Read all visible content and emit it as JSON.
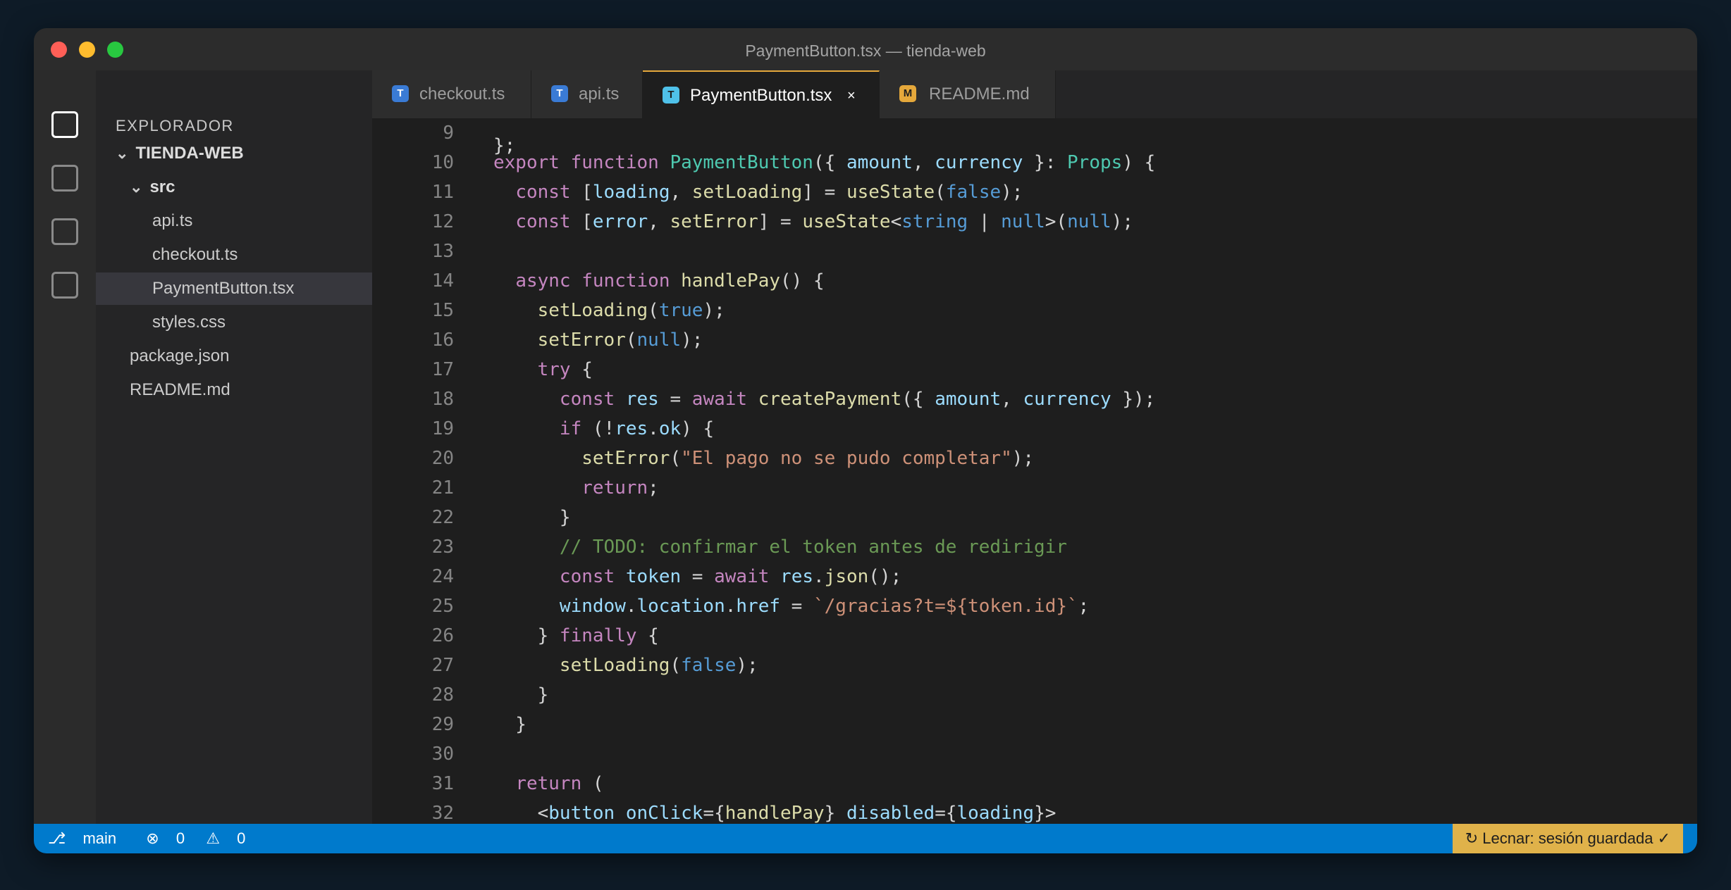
{
  "window": {
    "title": "PaymentButton.tsx — tienda-web"
  },
  "activity_bar": {
    "icons": [
      "explorer-icon",
      "search-icon",
      "source-control-icon",
      "extensions-icon"
    ]
  },
  "sidebar": {
    "title": "EXPLORADOR",
    "root": "TIENDA-WEB",
    "folder": "src",
    "items": [
      {
        "label": "api.ts"
      },
      {
        "label": "checkout.ts"
      },
      {
        "label": "PaymentButton.tsx"
      },
      {
        "label": "styles.css"
      },
      {
        "label": "package.json"
      },
      {
        "label": "README.md"
      }
    ],
    "selected": "PaymentButton.tsx"
  },
  "tabs": [
    {
      "badge": "T",
      "label": "checkout.ts",
      "badge_color": "#3a7bd5"
    },
    {
      "badge": "T",
      "label": "api.ts",
      "badge_color": "#3a7bd5"
    },
    {
      "badge": "T",
      "label": "PaymentButton.tsx",
      "badge_color": "#4fc1e9",
      "active": true,
      "close": "×"
    },
    {
      "badge": "M",
      "label": "README.md",
      "badge_color": "#e5a83b"
    }
  ],
  "editor": {
    "partial_top_line": "};",
    "line_numbers": [
      "9",
      "10",
      "11",
      "12",
      "13",
      "14",
      "15",
      "16",
      "17",
      "18",
      "19",
      "20",
      "21",
      "22",
      "23",
      "24",
      "25",
      "26",
      "27",
      "28",
      "29",
      "30",
      "31",
      "32"
    ],
    "lines": [
      "",
      "export function PaymentButton({ amount, currency }: Props) {",
      "  const [loading, setLoading] = useState(false);",
      "  const [error, setError] = useState<string | null>(null);",
      "",
      "  async function handlePay() {",
      "    setLoading(true);",
      "    setError(null);",
      "    try {",
      "      const res = await createPayment({ amount, currency });",
      "      if (!res.ok) {",
      "        setError(\"El pago no se pudo completar\");",
      "        return;",
      "      }",
      "      // TODO: confirmar el token antes de redirigir",
      "      const token = await res.json();",
      "      window.location.href = `/gracias?t=${token.id}`;",
      "    } finally {",
      "      setLoading(false);",
      "    }",
      "  }",
      "",
      "  return (",
      "    <button onClick={handlePay} disabled={loading}>"
    ]
  },
  "statusbar": {
    "branch": "main",
    "errors": "0",
    "warnings": "0",
    "right_text": "↻ Lecnar: sesión guardada ✓"
  }
}
